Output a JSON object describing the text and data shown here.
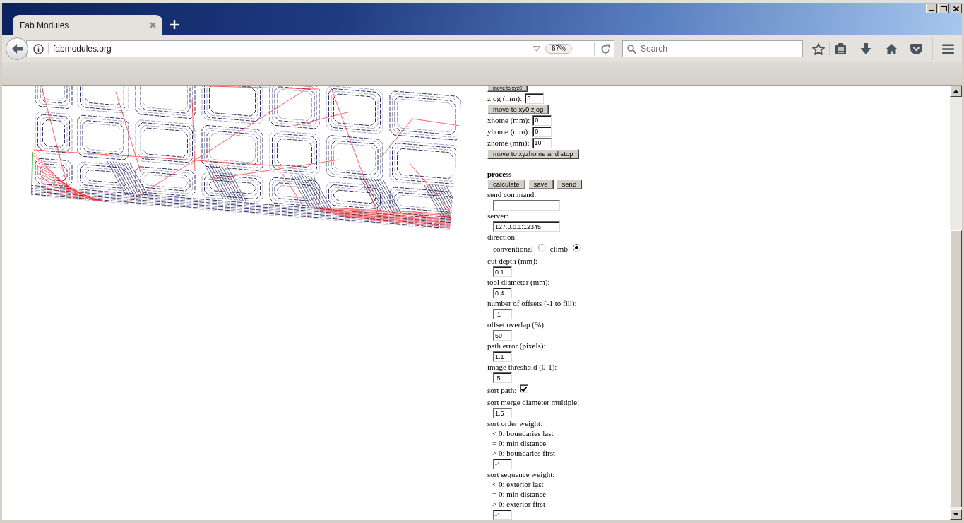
{
  "browser": {
    "tab": {
      "title": "Fab Modules"
    },
    "address_bar": {
      "url": "fabmodules.org",
      "zoom": "67%"
    },
    "search_field": {
      "placeholder": "Search"
    }
  },
  "panel": {
    "items": [
      {
        "kind": "buttons",
        "clipped": true,
        "buttons": [
          "move to xyz0"
        ]
      },
      {
        "kind": "inline_field",
        "label": "zjog (mm):",
        "value": "5"
      },
      {
        "kind": "buttons",
        "clipped": false,
        "buttons": [
          "move to xy0 zjog"
        ]
      },
      {
        "kind": "inline_field",
        "label": "xhome (mm):",
        "value": "0"
      },
      {
        "kind": "inline_field",
        "label": "yhome (mm):",
        "value": "0"
      },
      {
        "kind": "inline_field",
        "label": "zhome (mm):",
        "value": "10"
      },
      {
        "kind": "buttons",
        "clipped": false,
        "buttons": [
          "move to xyzhome and stop"
        ]
      },
      {
        "kind": "heading",
        "text": "process"
      },
      {
        "kind": "buttons",
        "clipped": false,
        "buttons": [
          "calculate",
          "save",
          "send"
        ]
      },
      {
        "kind": "label",
        "text": "send command:"
      },
      {
        "kind": "wide_field"
      },
      {
        "kind": "label",
        "text": "server:"
      },
      {
        "kind": "wide_field",
        "value": "127.0.0.1:12345"
      },
      {
        "kind": "label",
        "text": "direction:"
      },
      {
        "kind": "radios",
        "options": [
          {
            "label": "conventional",
            "selected": false
          },
          {
            "label": "climb",
            "selected": true
          }
        ]
      },
      {
        "kind": "label",
        "text": "cut depth (mm):"
      },
      {
        "kind": "field",
        "value": "0.1"
      },
      {
        "kind": "label",
        "text": "tool diameter (mm):"
      },
      {
        "kind": "field",
        "value": "0.4"
      },
      {
        "kind": "label",
        "text": "number of offsets (-1 to fill):"
      },
      {
        "kind": "field",
        "value": "-1"
      },
      {
        "kind": "label",
        "text": "offset overlap (%):"
      },
      {
        "kind": "field",
        "value": "50"
      },
      {
        "kind": "label",
        "text": "path error (pixels):"
      },
      {
        "kind": "field",
        "value": "1.1"
      },
      {
        "kind": "label",
        "text": "image threshold (0-1):"
      },
      {
        "kind": "field",
        "value": ".5"
      },
      {
        "kind": "checkbox",
        "label": "sort path:",
        "checked": true
      },
      {
        "kind": "label",
        "text": "sort merge diameter multiple:"
      },
      {
        "kind": "field",
        "value": "1.5"
      },
      {
        "kind": "label",
        "text": "sort order weight:"
      },
      {
        "kind": "note",
        "text": "< 0: boundaries last"
      },
      {
        "kind": "note",
        "text": "= 0: min distance"
      },
      {
        "kind": "note",
        "text": "> 0: boundaries first"
      },
      {
        "kind": "field",
        "value": "-1"
      },
      {
        "kind": "label",
        "text": "sort sequence weight:"
      },
      {
        "kind": "note",
        "text": "< 0: exterior last"
      },
      {
        "kind": "note",
        "text": "= 0: min distance"
      },
      {
        "kind": "note",
        "text": "> 0: exterior first"
      },
      {
        "kind": "field",
        "value": "-1"
      }
    ]
  }
}
